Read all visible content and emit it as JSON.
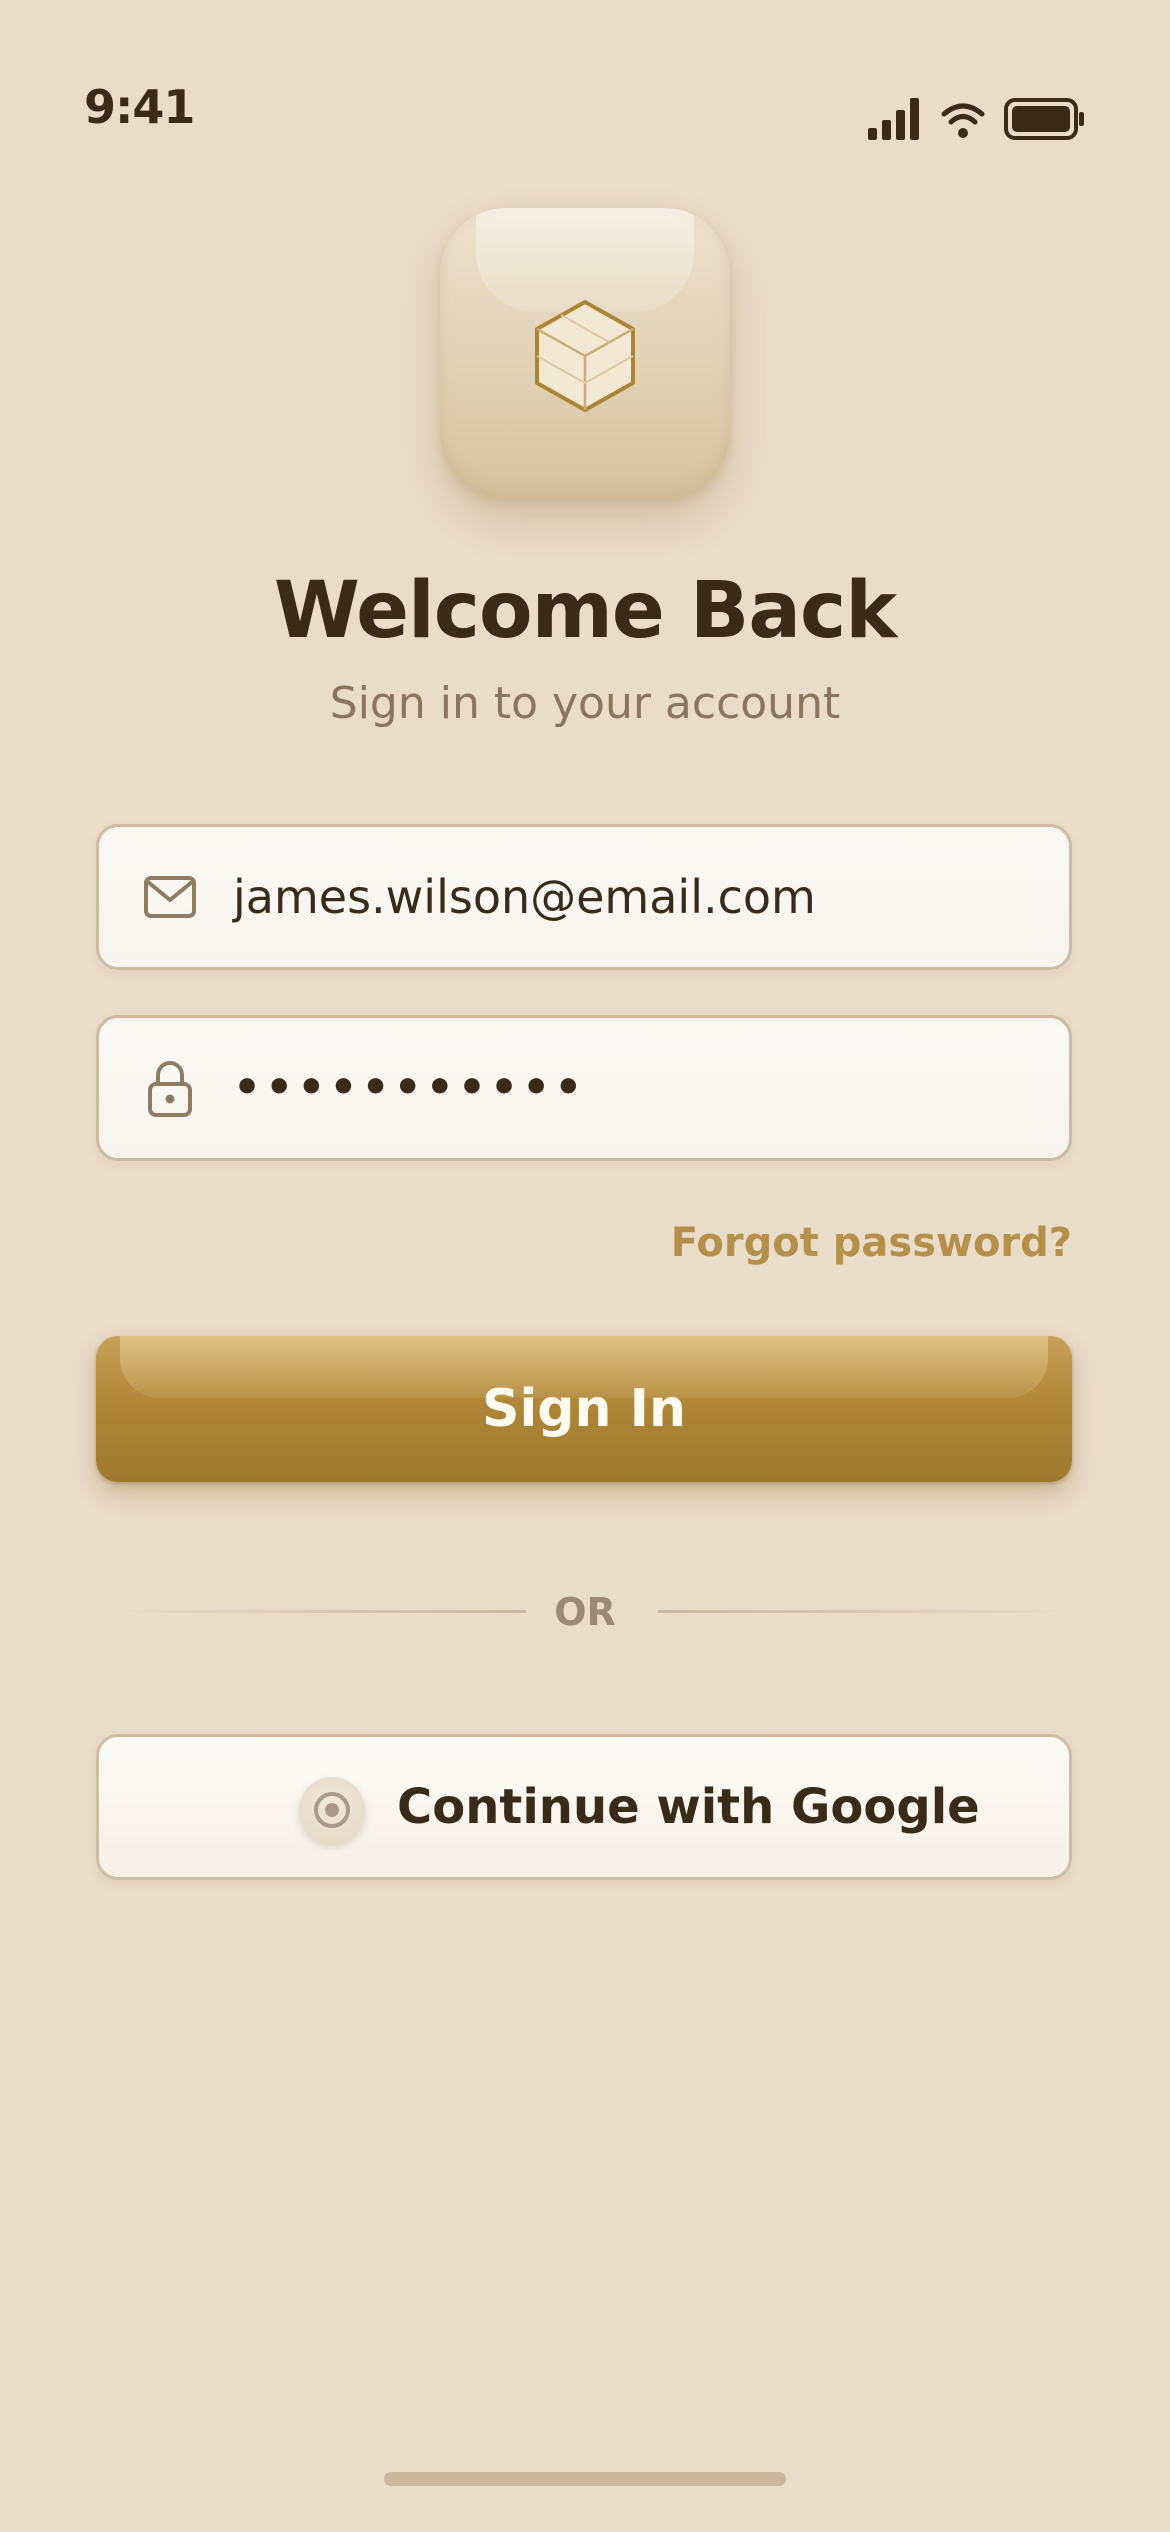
{
  "status_bar": {
    "time": "9:41",
    "icons": [
      "cellular-signal-icon",
      "wifi-icon",
      "battery-icon"
    ]
  },
  "app_icon": {
    "icon": "cube-icon"
  },
  "header": {
    "title": "Welcome Back",
    "subtitle": "Sign in to your account"
  },
  "form": {
    "email": {
      "icon": "mail-icon",
      "value": "james.wilson@email.com"
    },
    "password": {
      "icon": "lock-icon",
      "value": "•••••••••••"
    },
    "forgot_label": "Forgot password?",
    "signin_label": "Sign In"
  },
  "divider": {
    "label": "OR"
  },
  "social": {
    "google_icon": "google-icon",
    "google_label": "Continue with Google"
  },
  "colors": {
    "background": "#e9dcc8",
    "accent": "#b08637",
    "text_primary": "#3a2b18",
    "text_secondary": "#8a7560",
    "link": "#b5904a"
  }
}
